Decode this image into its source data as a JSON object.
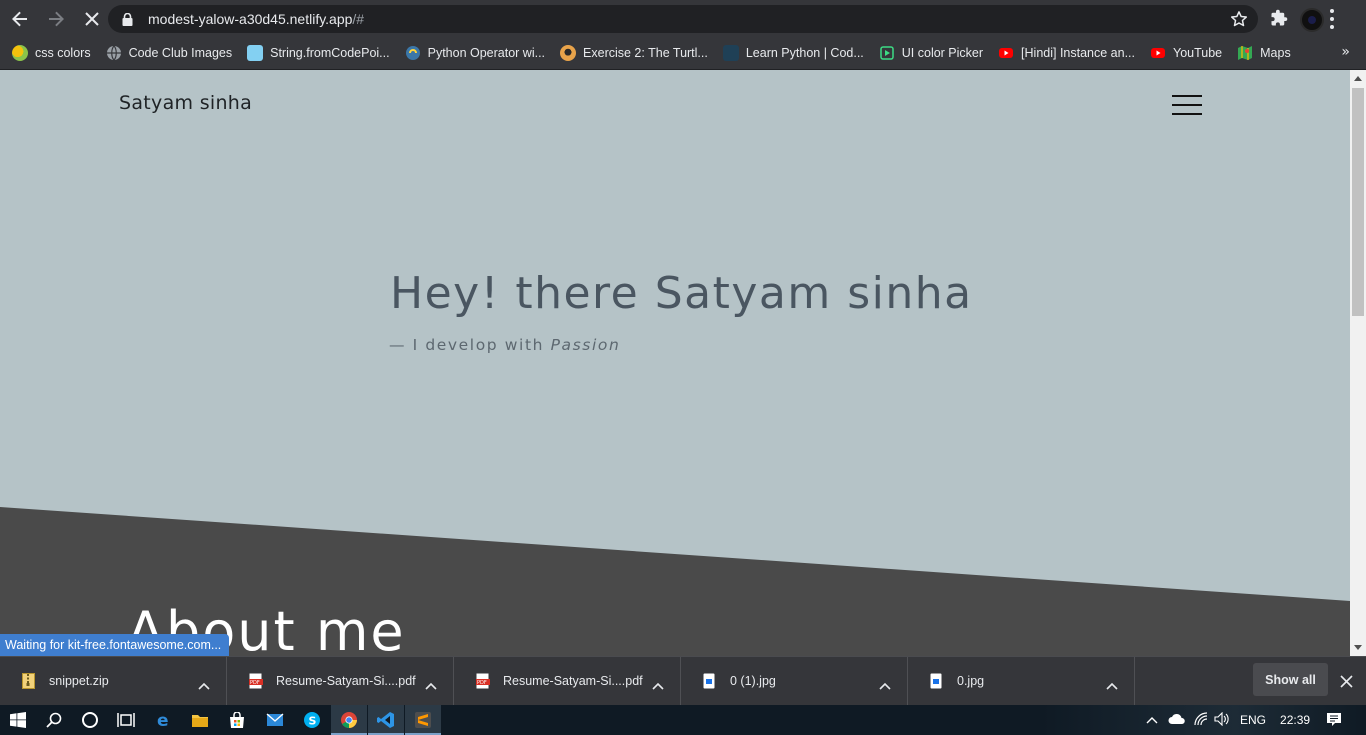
{
  "browser": {
    "url_host": "modest-yalow-a30d45.netlify.app",
    "url_path": "/#",
    "colors": {
      "frame": "#35363a",
      "omnibox": "#202124",
      "text": "#e8eaed"
    }
  },
  "bookmarks": [
    {
      "label": "css colors",
      "icon": "css-colors-icon",
      "color": "#f4c20d"
    },
    {
      "label": "Code Club Images",
      "icon": "globe-icon",
      "color": "#9aa0a6"
    },
    {
      "label": "String.fromCodePoi...",
      "icon": "mdn-icon",
      "color": "#83d0f2"
    },
    {
      "label": "Python Operator wi...",
      "icon": "python-icon",
      "color": "#3b77a8"
    },
    {
      "label": "Exercise 2: The Turtl...",
      "icon": "turtle-icon",
      "color": "#e8a34a"
    },
    {
      "label": "Learn Python | Cod...",
      "icon": "codecademy-icon",
      "color": "#1f4056"
    },
    {
      "label": "UI color Picker",
      "icon": "color-picker-icon",
      "color": "#3ddc84"
    },
    {
      "label": "[Hindi] Instance an...",
      "icon": "youtube-icon",
      "color": "#ff0000"
    },
    {
      "label": "YouTube",
      "icon": "youtube-icon",
      "color": "#ff0000"
    },
    {
      "label": "Maps",
      "icon": "maps-icon",
      "color": "#34a853"
    }
  ],
  "page": {
    "brand": "Satyam sinha",
    "hero_title": "Hey! there Satyam sinha",
    "hero_sub_prefix": "— I develop with ",
    "hero_sub_emphasis": "Passion",
    "about_title": "About me",
    "colors": {
      "background": "#b5c3c7",
      "dark_section": "#4a4a4a",
      "heading": "#4a5661"
    }
  },
  "status_text": "Waiting for kit-free.fontawesome.com...",
  "downloads": [
    {
      "name": "snippet.zip",
      "icon": "zip-file-icon"
    },
    {
      "name": "Resume-Satyam-Si....pdf",
      "icon": "pdf-file-icon"
    },
    {
      "name": "Resume-Satyam-Si....pdf",
      "icon": "pdf-file-icon"
    },
    {
      "name": "0 (1).jpg",
      "icon": "image-file-icon"
    },
    {
      "name": "0.jpg",
      "icon": "image-file-icon"
    }
  ],
  "downloads_show_all": "Show all",
  "taskbar": {
    "language": "ENG",
    "time": "22:39"
  }
}
